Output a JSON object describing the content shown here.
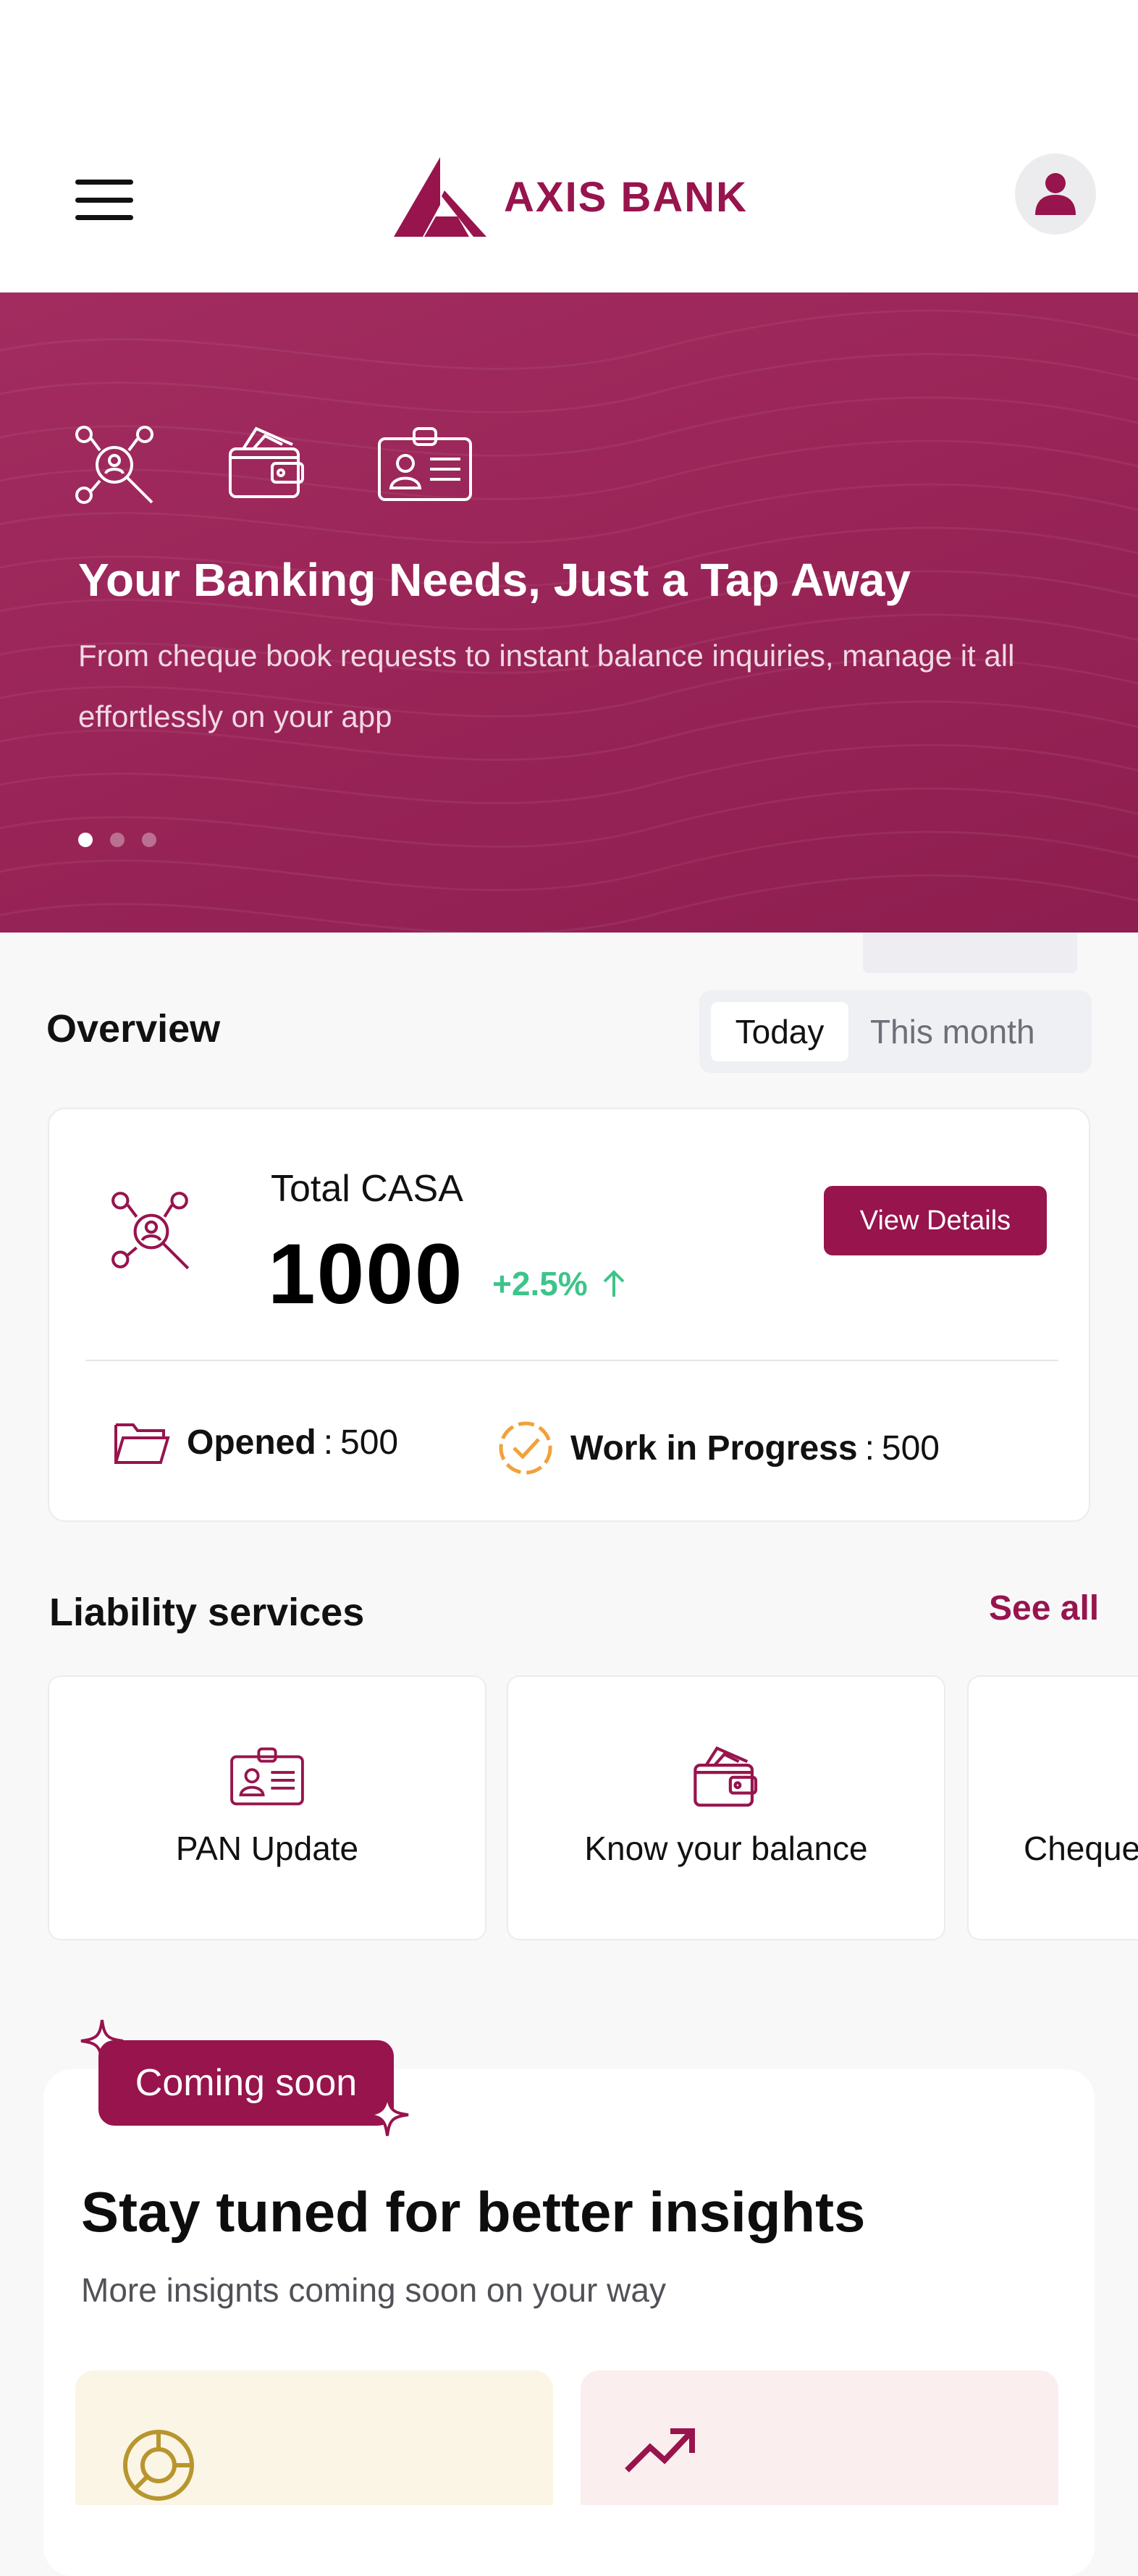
{
  "header": {
    "brand": "AXIS BANK",
    "menu_icon": "hamburger-icon",
    "profile_icon": "user-icon"
  },
  "hero": {
    "title": "Your Banking Needs, Just a Tap Away",
    "subtitle": "From cheque book requests to instant balance inquiries, manage it all effortlessly on your app",
    "icons": [
      "people-search-icon",
      "wallet-icon",
      "id-card-icon"
    ],
    "slides_total": 3,
    "slide_active": 1
  },
  "overview": {
    "title": "Overview",
    "tabs": [
      {
        "label": "Today",
        "active": true
      },
      {
        "label": "This month",
        "active": false
      }
    ],
    "casa": {
      "label": "Total CASA",
      "value": "1000",
      "delta": "+2.5%",
      "button": "View Details",
      "opened_label": "Opened",
      "opened_value": "500",
      "wip_label": "Work in Progress",
      "wip_value": "500",
      "separator": ":"
    }
  },
  "liability": {
    "title": "Liability services",
    "see_all": "See all",
    "items": [
      {
        "label": "PAN Update",
        "icon": "id-card-icon"
      },
      {
        "label": "Know your balance",
        "icon": "wallet-icon"
      },
      {
        "label": "Cheque",
        "icon": "cheque-icon"
      }
    ]
  },
  "insights": {
    "badge": "Coming soon",
    "title": "Stay tuned for better insights",
    "subtitle": "More insignts coming soon on your way",
    "cards": [
      {
        "icon": "pie-chart-icon",
        "bg": "#fbf5e6"
      },
      {
        "icon": "trend-up-icon",
        "bg": "#fbeeee"
      }
    ]
  },
  "colors": {
    "brand": "#97144d",
    "positive": "#3ec48a",
    "pending": "#f0a23a"
  }
}
